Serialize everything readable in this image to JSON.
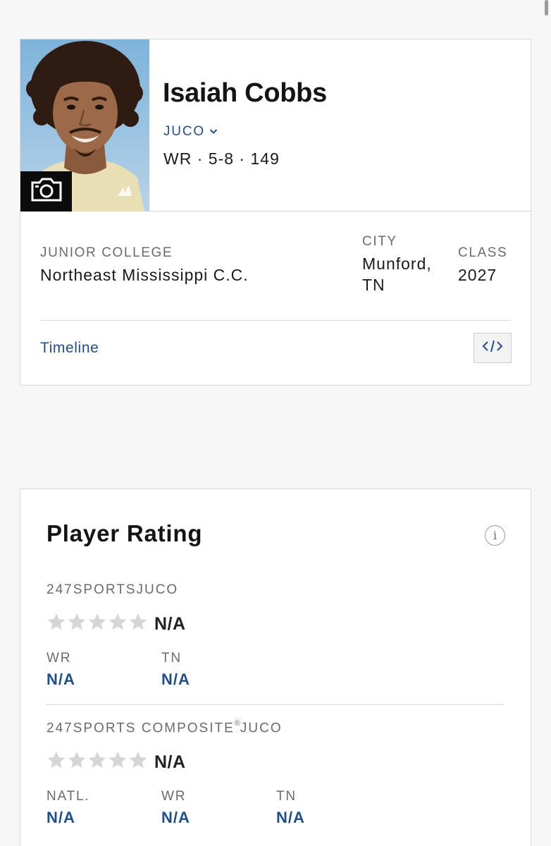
{
  "player": {
    "name": "Isaiah Cobbs",
    "level": "JUCO",
    "position": "WR",
    "height": "5-8",
    "weight": "149",
    "separator": "·"
  },
  "info": {
    "college_label": "JUNIOR COLLEGE",
    "college_value": "Northeast Mississippi C.C.",
    "city_label": "CITY",
    "city_value": "Munford, TN",
    "class_label": "CLASS",
    "class_value": "2027"
  },
  "links": {
    "timeline": "Timeline"
  },
  "icons": {
    "camera": "camera-icon",
    "embed": "code-embed-icon",
    "info": "info-icon",
    "chevron": "chevron-down-icon",
    "star": "star-icon"
  },
  "colors": {
    "link": "#1f4e8c",
    "star_empty": "#d6d6d6",
    "label": "#6b6b6b"
  },
  "rating": {
    "title": "Player Rating",
    "info_glyph": "i",
    "sources": [
      {
        "name": "247SPORTS",
        "suffix": "JUCO",
        "stars": 0,
        "stars_max": 5,
        "score": "N/A",
        "ranks": [
          {
            "label": "WR",
            "value": "N/A"
          },
          {
            "label": "TN",
            "value": "N/A"
          }
        ]
      },
      {
        "name": "247SPORTS COMPOSITE",
        "reg": "®",
        "suffix": "JUCO",
        "stars": 0,
        "stars_max": 5,
        "score": "N/A",
        "ranks": [
          {
            "label": "NATL.",
            "value": "N/A"
          },
          {
            "label": "WR",
            "value": "N/A"
          },
          {
            "label": "TN",
            "value": "N/A"
          }
        ]
      }
    ]
  }
}
